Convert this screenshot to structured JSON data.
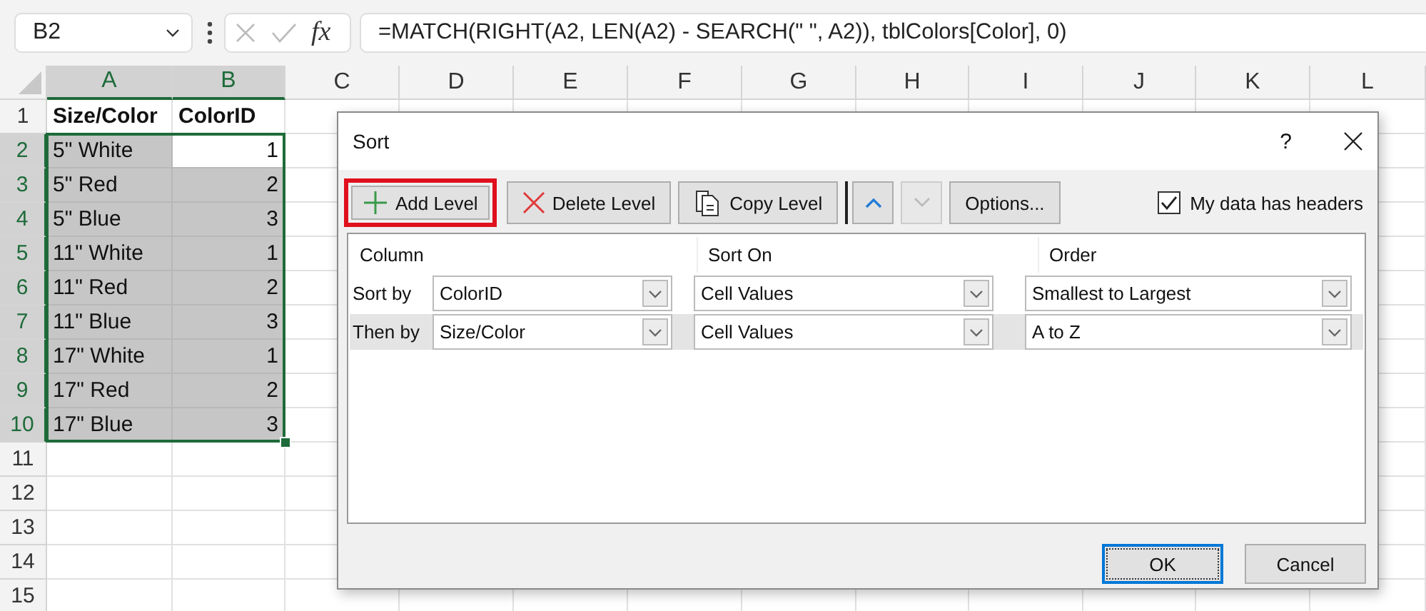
{
  "name_box": {
    "value": "B2"
  },
  "formula_bar": {
    "fx_label": "fx",
    "value": "=MATCH(RIGHT(A2, LEN(A2) - SEARCH(\" \", A2)), tblColors[Color], 0)"
  },
  "columns": [
    {
      "label": "A",
      "selected": true
    },
    {
      "label": "B",
      "selected": true
    },
    {
      "label": "C",
      "selected": false
    },
    {
      "label": "D",
      "selected": false
    },
    {
      "label": "E",
      "selected": false
    },
    {
      "label": "F",
      "selected": false
    },
    {
      "label": "G",
      "selected": false
    },
    {
      "label": "H",
      "selected": false
    },
    {
      "label": "I",
      "selected": false
    },
    {
      "label": "J",
      "selected": false
    },
    {
      "label": "K",
      "selected": false
    },
    {
      "label": "L",
      "selected": false
    }
  ],
  "rows": [
    {
      "header": "1",
      "selected": false,
      "cells": [
        {
          "text": "Size/Color",
          "kind": "heading",
          "selected": false,
          "active": false
        },
        {
          "text": "ColorID",
          "kind": "heading",
          "selected": false,
          "active": false
        }
      ]
    },
    {
      "header": "2",
      "selected": true,
      "cells": [
        {
          "text": "5\" White",
          "kind": "text",
          "selected": true,
          "active": false
        },
        {
          "text": "1",
          "kind": "number",
          "selected": true,
          "active": true
        }
      ]
    },
    {
      "header": "3",
      "selected": true,
      "cells": [
        {
          "text": "5\" Red",
          "kind": "text",
          "selected": true,
          "active": false
        },
        {
          "text": "2",
          "kind": "number",
          "selected": true,
          "active": false
        }
      ]
    },
    {
      "header": "4",
      "selected": true,
      "cells": [
        {
          "text": "5\" Blue",
          "kind": "text",
          "selected": true,
          "active": false
        },
        {
          "text": "3",
          "kind": "number",
          "selected": true,
          "active": false
        }
      ]
    },
    {
      "header": "5",
      "selected": true,
      "cells": [
        {
          "text": "11\" White",
          "kind": "text",
          "selected": true,
          "active": false
        },
        {
          "text": "1",
          "kind": "number",
          "selected": true,
          "active": false
        }
      ]
    },
    {
      "header": "6",
      "selected": true,
      "cells": [
        {
          "text": "11\" Red",
          "kind": "text",
          "selected": true,
          "active": false
        },
        {
          "text": "2",
          "kind": "number",
          "selected": true,
          "active": false
        }
      ]
    },
    {
      "header": "7",
      "selected": true,
      "cells": [
        {
          "text": "11\" Blue",
          "kind": "text",
          "selected": true,
          "active": false
        },
        {
          "text": "3",
          "kind": "number",
          "selected": true,
          "active": false
        }
      ]
    },
    {
      "header": "8",
      "selected": true,
      "cells": [
        {
          "text": "17\" White",
          "kind": "text",
          "selected": true,
          "active": false
        },
        {
          "text": "1",
          "kind": "number",
          "selected": true,
          "active": false
        }
      ]
    },
    {
      "header": "9",
      "selected": true,
      "cells": [
        {
          "text": "17\" Red",
          "kind": "text",
          "selected": true,
          "active": false
        },
        {
          "text": "2",
          "kind": "number",
          "selected": true,
          "active": false
        }
      ]
    },
    {
      "header": "10",
      "selected": true,
      "cells": [
        {
          "text": "17\" Blue",
          "kind": "text",
          "selected": true,
          "active": false
        },
        {
          "text": "3",
          "kind": "number",
          "selected": true,
          "active": false
        }
      ]
    },
    {
      "header": "11",
      "selected": false,
      "cells": []
    },
    {
      "header": "12",
      "selected": false,
      "cells": []
    },
    {
      "header": "13",
      "selected": false,
      "cells": []
    },
    {
      "header": "14",
      "selected": false,
      "cells": []
    },
    {
      "header": "15",
      "selected": false,
      "cells": []
    }
  ],
  "dialog": {
    "title": "Sort",
    "help": "?",
    "toolbar": [
      {
        "kind": "add",
        "label": "Add Level",
        "highlighted": true,
        "disabled": false
      },
      {
        "kind": "delete",
        "label": "Delete Level",
        "highlighted": false,
        "disabled": false
      },
      {
        "kind": "copy",
        "label": "Copy Level",
        "highlighted": false,
        "disabled": false
      },
      {
        "kind": "up",
        "highlighted": false,
        "disabled": false
      },
      {
        "kind": "down",
        "highlighted": false,
        "disabled": true
      },
      {
        "kind": "options",
        "label": "Options...",
        "highlighted": false,
        "disabled": false
      }
    ],
    "headers_checkbox": {
      "label": "My data has headers",
      "checked": true
    },
    "grid_headers": [
      "Column",
      "Sort On",
      "Order"
    ],
    "levels": [
      {
        "label": "Sort by",
        "column": "ColorID",
        "sort_on": "Cell Values",
        "order": "Smallest to Largest",
        "selected": false
      },
      {
        "label": "Then by",
        "column": "Size/Color",
        "sort_on": "Cell Values",
        "order": "A to Z",
        "selected": true
      }
    ],
    "buttons": [
      {
        "label": "OK",
        "default": true
      },
      {
        "label": "Cancel",
        "default": false
      }
    ]
  }
}
